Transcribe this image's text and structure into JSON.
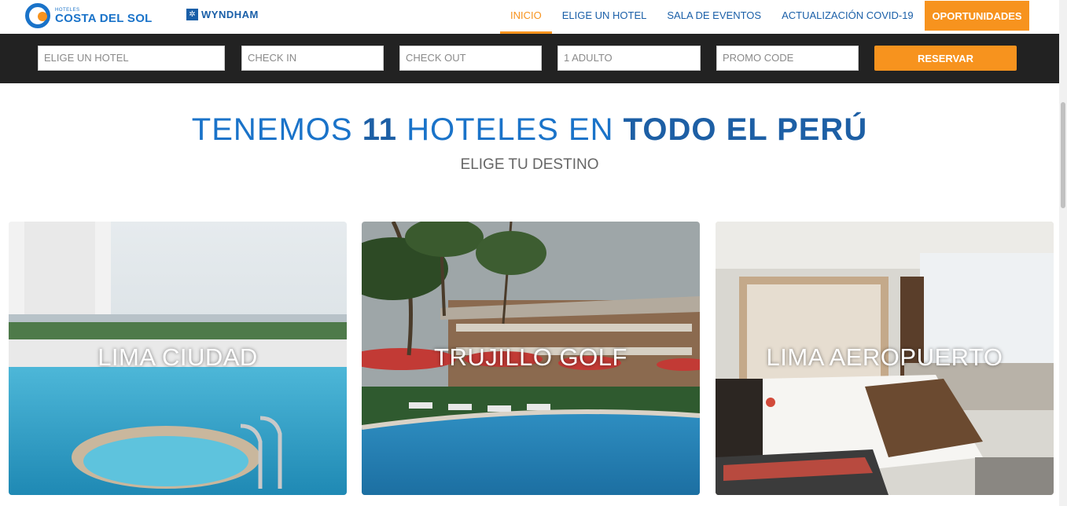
{
  "header": {
    "logo_small": "HOTELES",
    "logo_main": "COSTA DEL SOL",
    "partner": "WYNDHAM",
    "nav": [
      "INICIO",
      "ELIGE UN HOTEL",
      "SALA DE EVENTOS",
      "ACTUALIZACIÓN COVID-19"
    ],
    "cta": "OPORTUNIDADES",
    "active_color": "#f7931e",
    "nav_color": "#1a5fa8"
  },
  "booking": {
    "hotel_placeholder": "ELIGE UN HOTEL",
    "checkin_placeholder": "CHECK IN",
    "checkout_placeholder": "CHECK OUT",
    "guests_value": "1 ADULTO",
    "promo_placeholder": "PROMO CODE",
    "submit_label": "RESERVAR"
  },
  "hero": {
    "part1": "TENEMOS ",
    "part2": "11",
    "part3": " HOTELES EN ",
    "part4": "TODO EL PERÚ",
    "subtitle": "ELIGE TU DESTINO"
  },
  "cards": [
    {
      "title": "LIMA CIUDAD"
    },
    {
      "title": "TRUJILLO GOLF"
    },
    {
      "title": "LIMA AEROPUERTO"
    }
  ]
}
